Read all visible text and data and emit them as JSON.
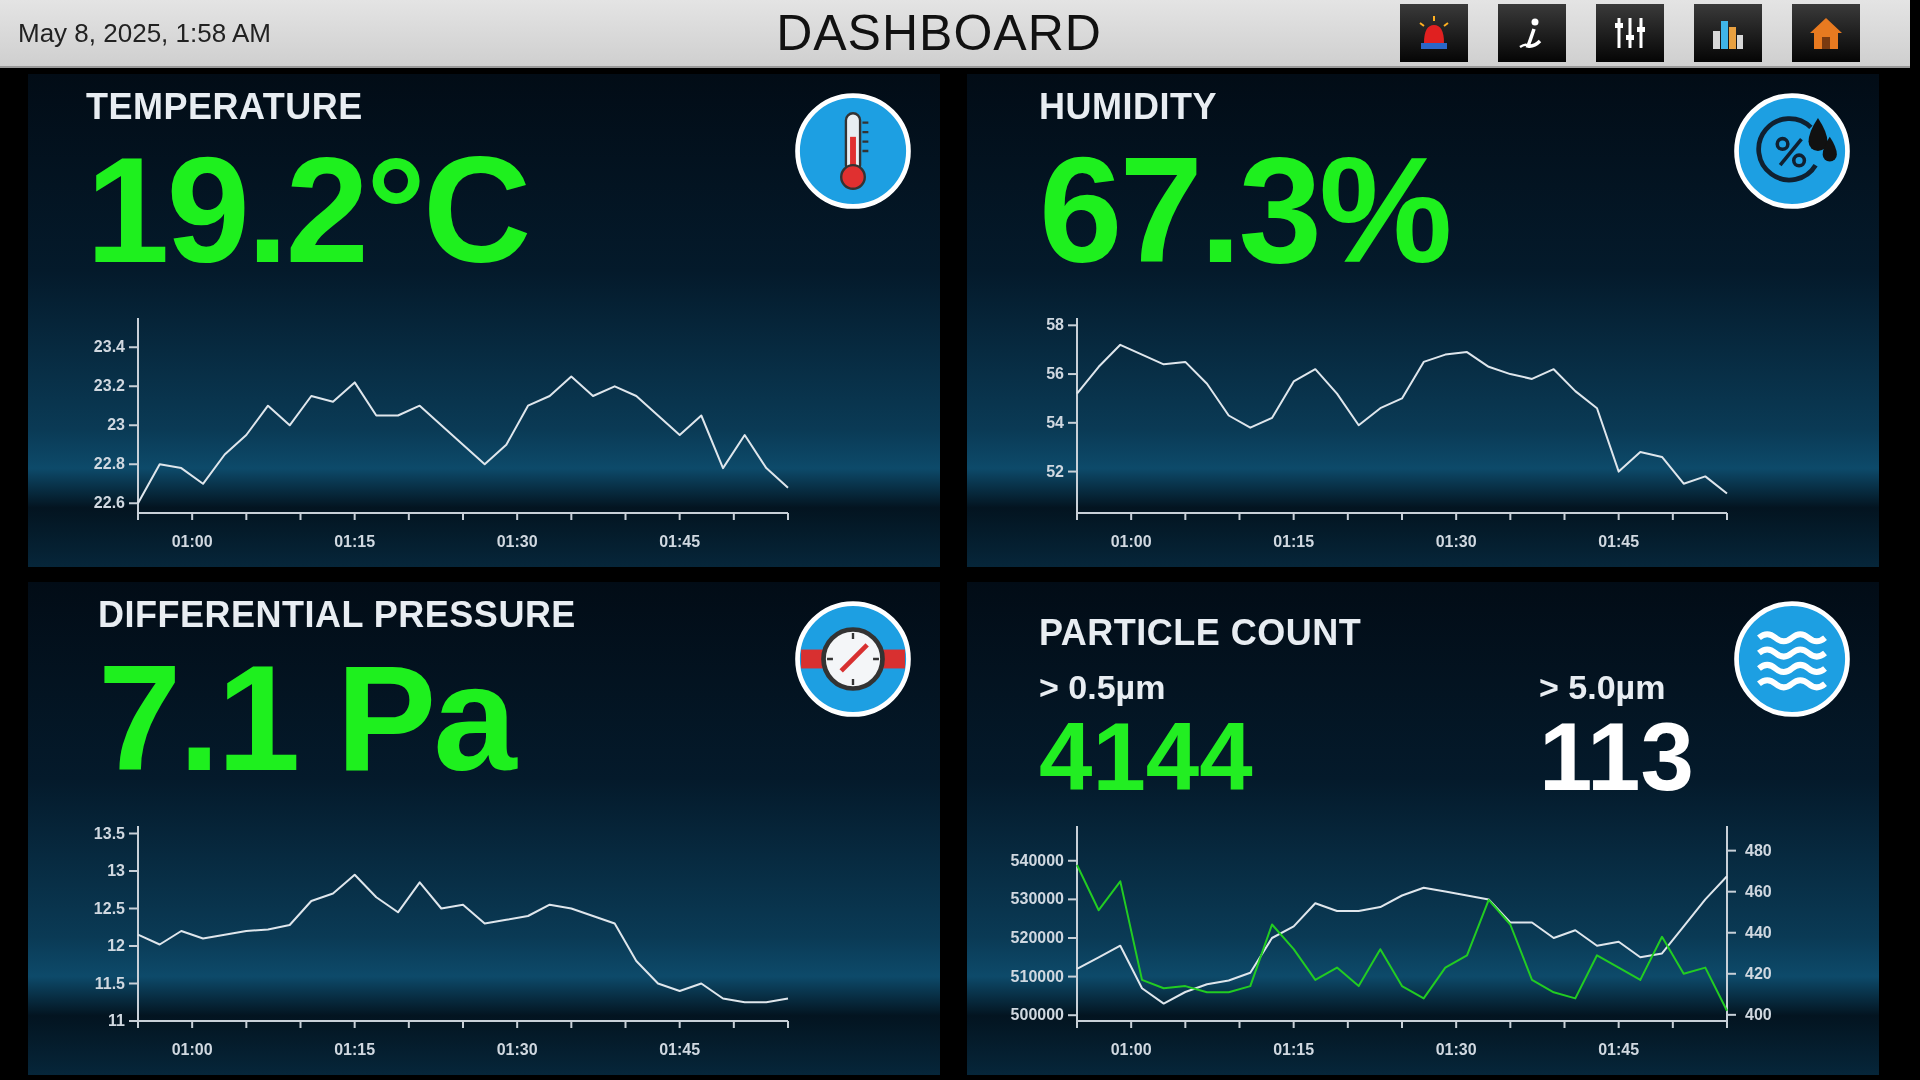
{
  "top_bar": {
    "datetime": "May 8, 2025, 1:58 AM",
    "title": "DASHBOARD"
  },
  "panels": [
    {
      "kind": "temperature",
      "title": "TEMPERATURE",
      "value": "19.2°C",
      "chart_data": {
        "type": "line",
        "x": [
          55,
          57,
          59,
          61,
          63,
          65,
          67,
          69,
          71,
          73,
          75,
          77,
          79,
          81,
          83,
          85,
          87,
          89,
          91,
          93,
          95,
          97,
          99,
          101,
          103,
          105,
          107,
          109,
          111,
          113,
          115
        ],
        "xlim": [
          55,
          115
        ],
        "xticks": [
          {
            "value": 60,
            "label": "01:00"
          },
          {
            "value": 75,
            "label": "01:15"
          },
          {
            "value": 90,
            "label": "01:30"
          },
          {
            "value": 105,
            "label": "01:45"
          }
        ],
        "ylim": [
          22.55,
          23.55
        ],
        "yticks": [
          22.6,
          22.8,
          23,
          23.2,
          23.4
        ],
        "series": [
          {
            "color": "#dfe6ec",
            "values": [
              22.6,
              22.8,
              22.78,
              22.7,
              22.85,
              22.95,
              23.1,
              23.0,
              23.15,
              23.12,
              23.22,
              23.05,
              23.05,
              23.1,
              23.0,
              22.9,
              22.8,
              22.9,
              23.1,
              23.15,
              23.25,
              23.15,
              23.2,
              23.15,
              23.05,
              22.95,
              23.05,
              22.78,
              22.95,
              22.78,
              22.68
            ]
          }
        ]
      }
    },
    {
      "kind": "humidity",
      "title": "HUMIDITY",
      "value": "67.3%",
      "chart_data": {
        "type": "line",
        "x": [
          55,
          57,
          59,
          61,
          63,
          65,
          67,
          69,
          71,
          73,
          75,
          77,
          79,
          81,
          83,
          85,
          87,
          89,
          91,
          93,
          95,
          97,
          99,
          101,
          103,
          105,
          107,
          109,
          111,
          113,
          115
        ],
        "xlim": [
          55,
          115
        ],
        "xticks": [
          {
            "value": 60,
            "label": "01:00"
          },
          {
            "value": 75,
            "label": "01:15"
          },
          {
            "value": 90,
            "label": "01:30"
          },
          {
            "value": 105,
            "label": "01:45"
          }
        ],
        "ylim": [
          50.3,
          58.3
        ],
        "yticks": [
          52,
          54,
          56,
          58
        ],
        "series": [
          {
            "color": "#dfe6ec",
            "values": [
              55.2,
              56.3,
              57.2,
              56.8,
              56.4,
              56.5,
              55.6,
              54.3,
              53.8,
              54.2,
              55.7,
              56.2,
              55.2,
              53.9,
              54.6,
              55.0,
              56.5,
              56.8,
              56.9,
              56.3,
              56.0,
              55.8,
              56.2,
              55.3,
              54.6,
              52.0,
              52.8,
              52.6,
              51.5,
              51.8,
              51.1
            ]
          }
        ]
      }
    },
    {
      "kind": "pressure",
      "title": "DIFFERENTIAL PRESSURE",
      "value": "7.1 Pa",
      "chart_data": {
        "type": "line",
        "x": [
          55,
          57,
          59,
          61,
          63,
          65,
          67,
          69,
          71,
          73,
          75,
          77,
          79,
          81,
          83,
          85,
          87,
          89,
          91,
          93,
          95,
          97,
          99,
          101,
          103,
          105,
          107,
          109,
          111,
          113,
          115
        ],
        "xlim": [
          55,
          115
        ],
        "xticks": [
          {
            "value": 60,
            "label": "01:00"
          },
          {
            "value": 75,
            "label": "01:15"
          },
          {
            "value": 90,
            "label": "01:30"
          },
          {
            "value": 105,
            "label": "01:45"
          }
        ],
        "ylim": [
          11,
          13.6
        ],
        "yticks": [
          11,
          11.5,
          12,
          12.5,
          13,
          13.5
        ],
        "series": [
          {
            "color": "#dfe6ec",
            "values": [
              12.15,
              12.02,
              12.2,
              12.1,
              12.15,
              12.2,
              12.22,
              12.28,
              12.6,
              12.7,
              12.95,
              12.65,
              12.45,
              12.85,
              12.5,
              12.55,
              12.3,
              12.35,
              12.4,
              12.55,
              12.5,
              12.4,
              12.3,
              11.8,
              11.5,
              11.4,
              11.5,
              11.3,
              11.25,
              11.25,
              11.3
            ]
          }
        ]
      }
    },
    {
      "kind": "particles",
      "title": "PARTICLE COUNT",
      "readings": [
        {
          "label": "> 0.5µm",
          "value": "4144",
          "color": "#22ee22"
        },
        {
          "label": "> 5.0µm",
          "value": "113",
          "color": "#ffffff"
        }
      ],
      "chart_data": {
        "type": "line",
        "x": [
          55,
          57,
          59,
          61,
          63,
          65,
          67,
          69,
          71,
          73,
          75,
          77,
          79,
          81,
          83,
          85,
          87,
          89,
          91,
          93,
          95,
          97,
          99,
          101,
          103,
          105,
          107,
          109,
          111,
          113,
          115
        ],
        "xlim": [
          55,
          115
        ],
        "xticks": [
          {
            "value": 60,
            "label": "01:00"
          },
          {
            "value": 75,
            "label": "01:15"
          },
          {
            "value": 90,
            "label": "01:30"
          },
          {
            "value": 105,
            "label": "01:45"
          }
        ],
        "ylim": [
          498500,
          549000
        ],
        "yticks": [
          500000,
          510000,
          520000,
          530000,
          540000
        ],
        "y2lim": [
          397,
          492
        ],
        "y2ticks": [
          400,
          420,
          440,
          460,
          480
        ],
        "series": [
          {
            "color": "#dfe6ec",
            "values": [
              512000,
              515000,
              518000,
              507000,
              503000,
              506000,
              508000,
              509000,
              511000,
              520000,
              523000,
              529000,
              527000,
              527000,
              528000,
              531000,
              533000,
              532000,
              531000,
              530000,
              524000,
              524000,
              520000,
              522000,
              518000,
              519000,
              515000,
              516000,
              523000,
              530000,
              536000
            ]
          },
          {
            "color": "#22cc22",
            "axis": "y2",
            "values": [
              473,
              451,
              465,
              417,
              413,
              414,
              411,
              411,
              414,
              444,
              432,
              417,
              423,
              414,
              432,
              414,
              408,
              423,
              429,
              456,
              444,
              417,
              411,
              408,
              429,
              423,
              417,
              438,
              420,
              423,
              402
            ]
          }
        ]
      }
    }
  ]
}
